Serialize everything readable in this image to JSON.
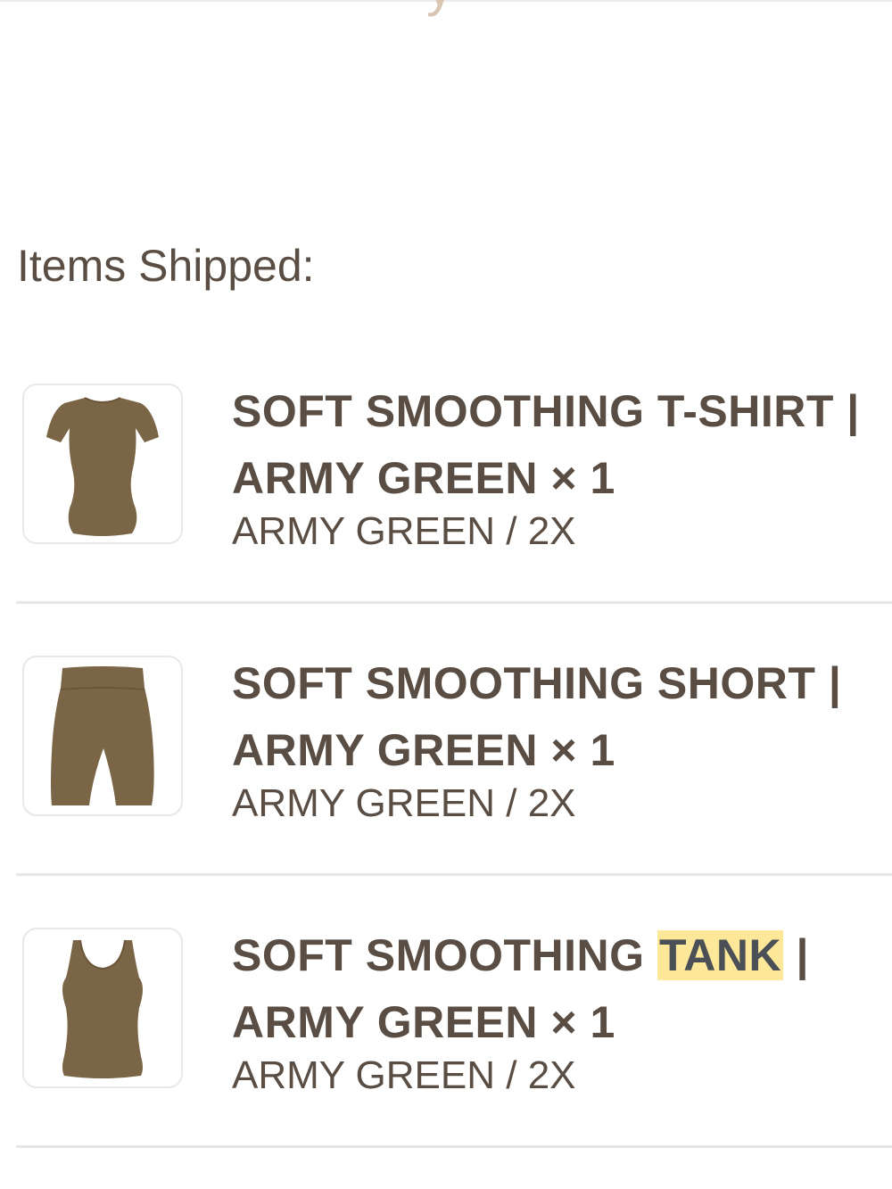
{
  "section": {
    "title": "Items Shipped:"
  },
  "items": [
    {
      "name_line1": "SOFT SMOOTHING T-SHIRT |",
      "name_line2": "ARMY GREEN × 1",
      "variant": "ARMY GREEN / 2X",
      "image_icon": "tshirt-icon"
    },
    {
      "name_line1": "SOFT SMOOTHING SHORT |",
      "name_line2": "ARMY GREEN × 1",
      "variant": "ARMY GREEN / 2X",
      "image_icon": "shorts-icon"
    },
    {
      "name_line1_pre": "SOFT SMOOTHING ",
      "name_line1_highlight": "TANK",
      "name_line1_post": " |",
      "name_line2": "ARMY GREEN × 1",
      "variant": "ARMY GREEN / 2X",
      "image_icon": "tank-top-icon"
    }
  ],
  "colors": {
    "text": "#5a4e44",
    "product": "#7a6546",
    "highlight": "#fde89a",
    "divider": "#e6e6e6"
  }
}
